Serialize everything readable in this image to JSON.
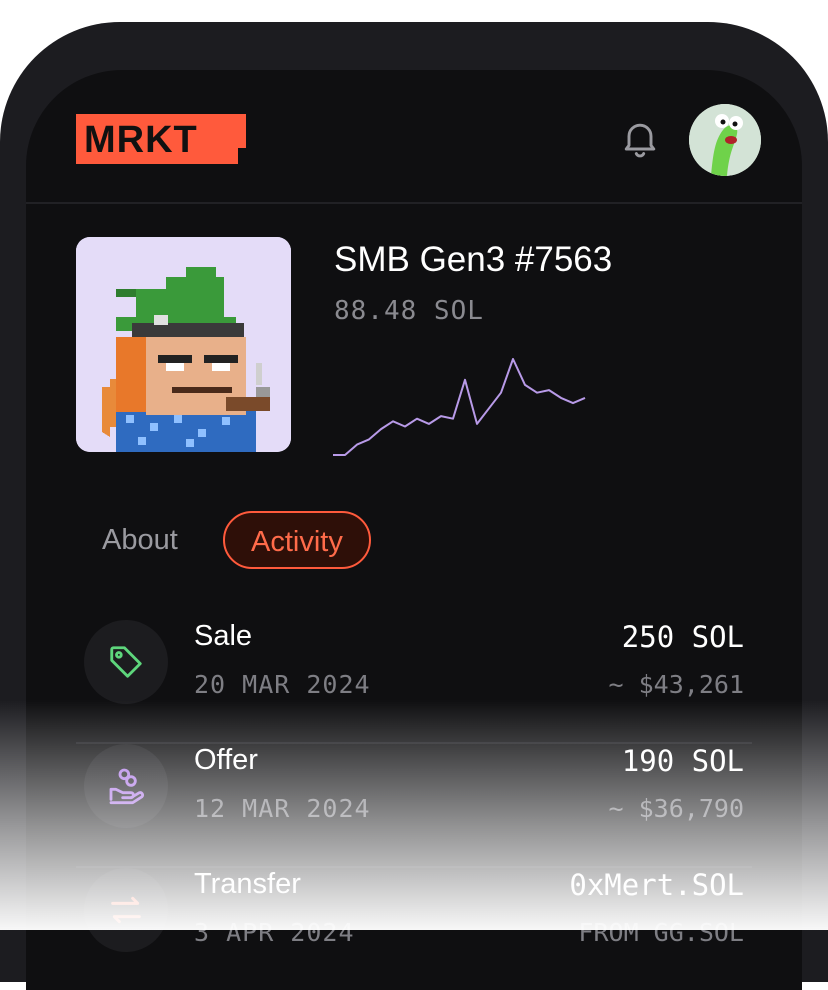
{
  "header": {
    "logo_text": "MRKT",
    "brand_color": "#ff5a3c",
    "notification_icon": "bell-icon",
    "avatar_icon": "user-avatar"
  },
  "nft": {
    "title": "SMB Gen3 #7563",
    "price": "88.48 SOL",
    "image": "pixel-monkey-wizard-hat"
  },
  "chart_data": {
    "type": "line",
    "series_color": "#b89ae8",
    "values": [
      0,
      0,
      8,
      12,
      20,
      26,
      22,
      28,
      24,
      30,
      28,
      58,
      24,
      36,
      48,
      74,
      54,
      48,
      50,
      44,
      40,
      44
    ]
  },
  "tabs": [
    {
      "label": "About",
      "active": false
    },
    {
      "label": "Activity",
      "active": true
    }
  ],
  "activity": [
    {
      "type": "Sale",
      "date": "20 MAR 2024",
      "amount": "250 SOL",
      "sub": "~ $43,261",
      "icon": "tag-icon",
      "icon_color": "#5ed67c"
    },
    {
      "type": "Offer",
      "date": "12 MAR 2024",
      "amount": "190 SOL",
      "sub": "~ $36,790",
      "icon": "hand-coins-icon",
      "icon_color": "#b07ce8"
    },
    {
      "type": "Transfer",
      "date": "3 APR 2024",
      "amount": "0xMert.SOL",
      "sub": "FROM GG.SOL",
      "icon": "transfer-arrows-icon",
      "icon_color": "#ff7a5c"
    }
  ]
}
